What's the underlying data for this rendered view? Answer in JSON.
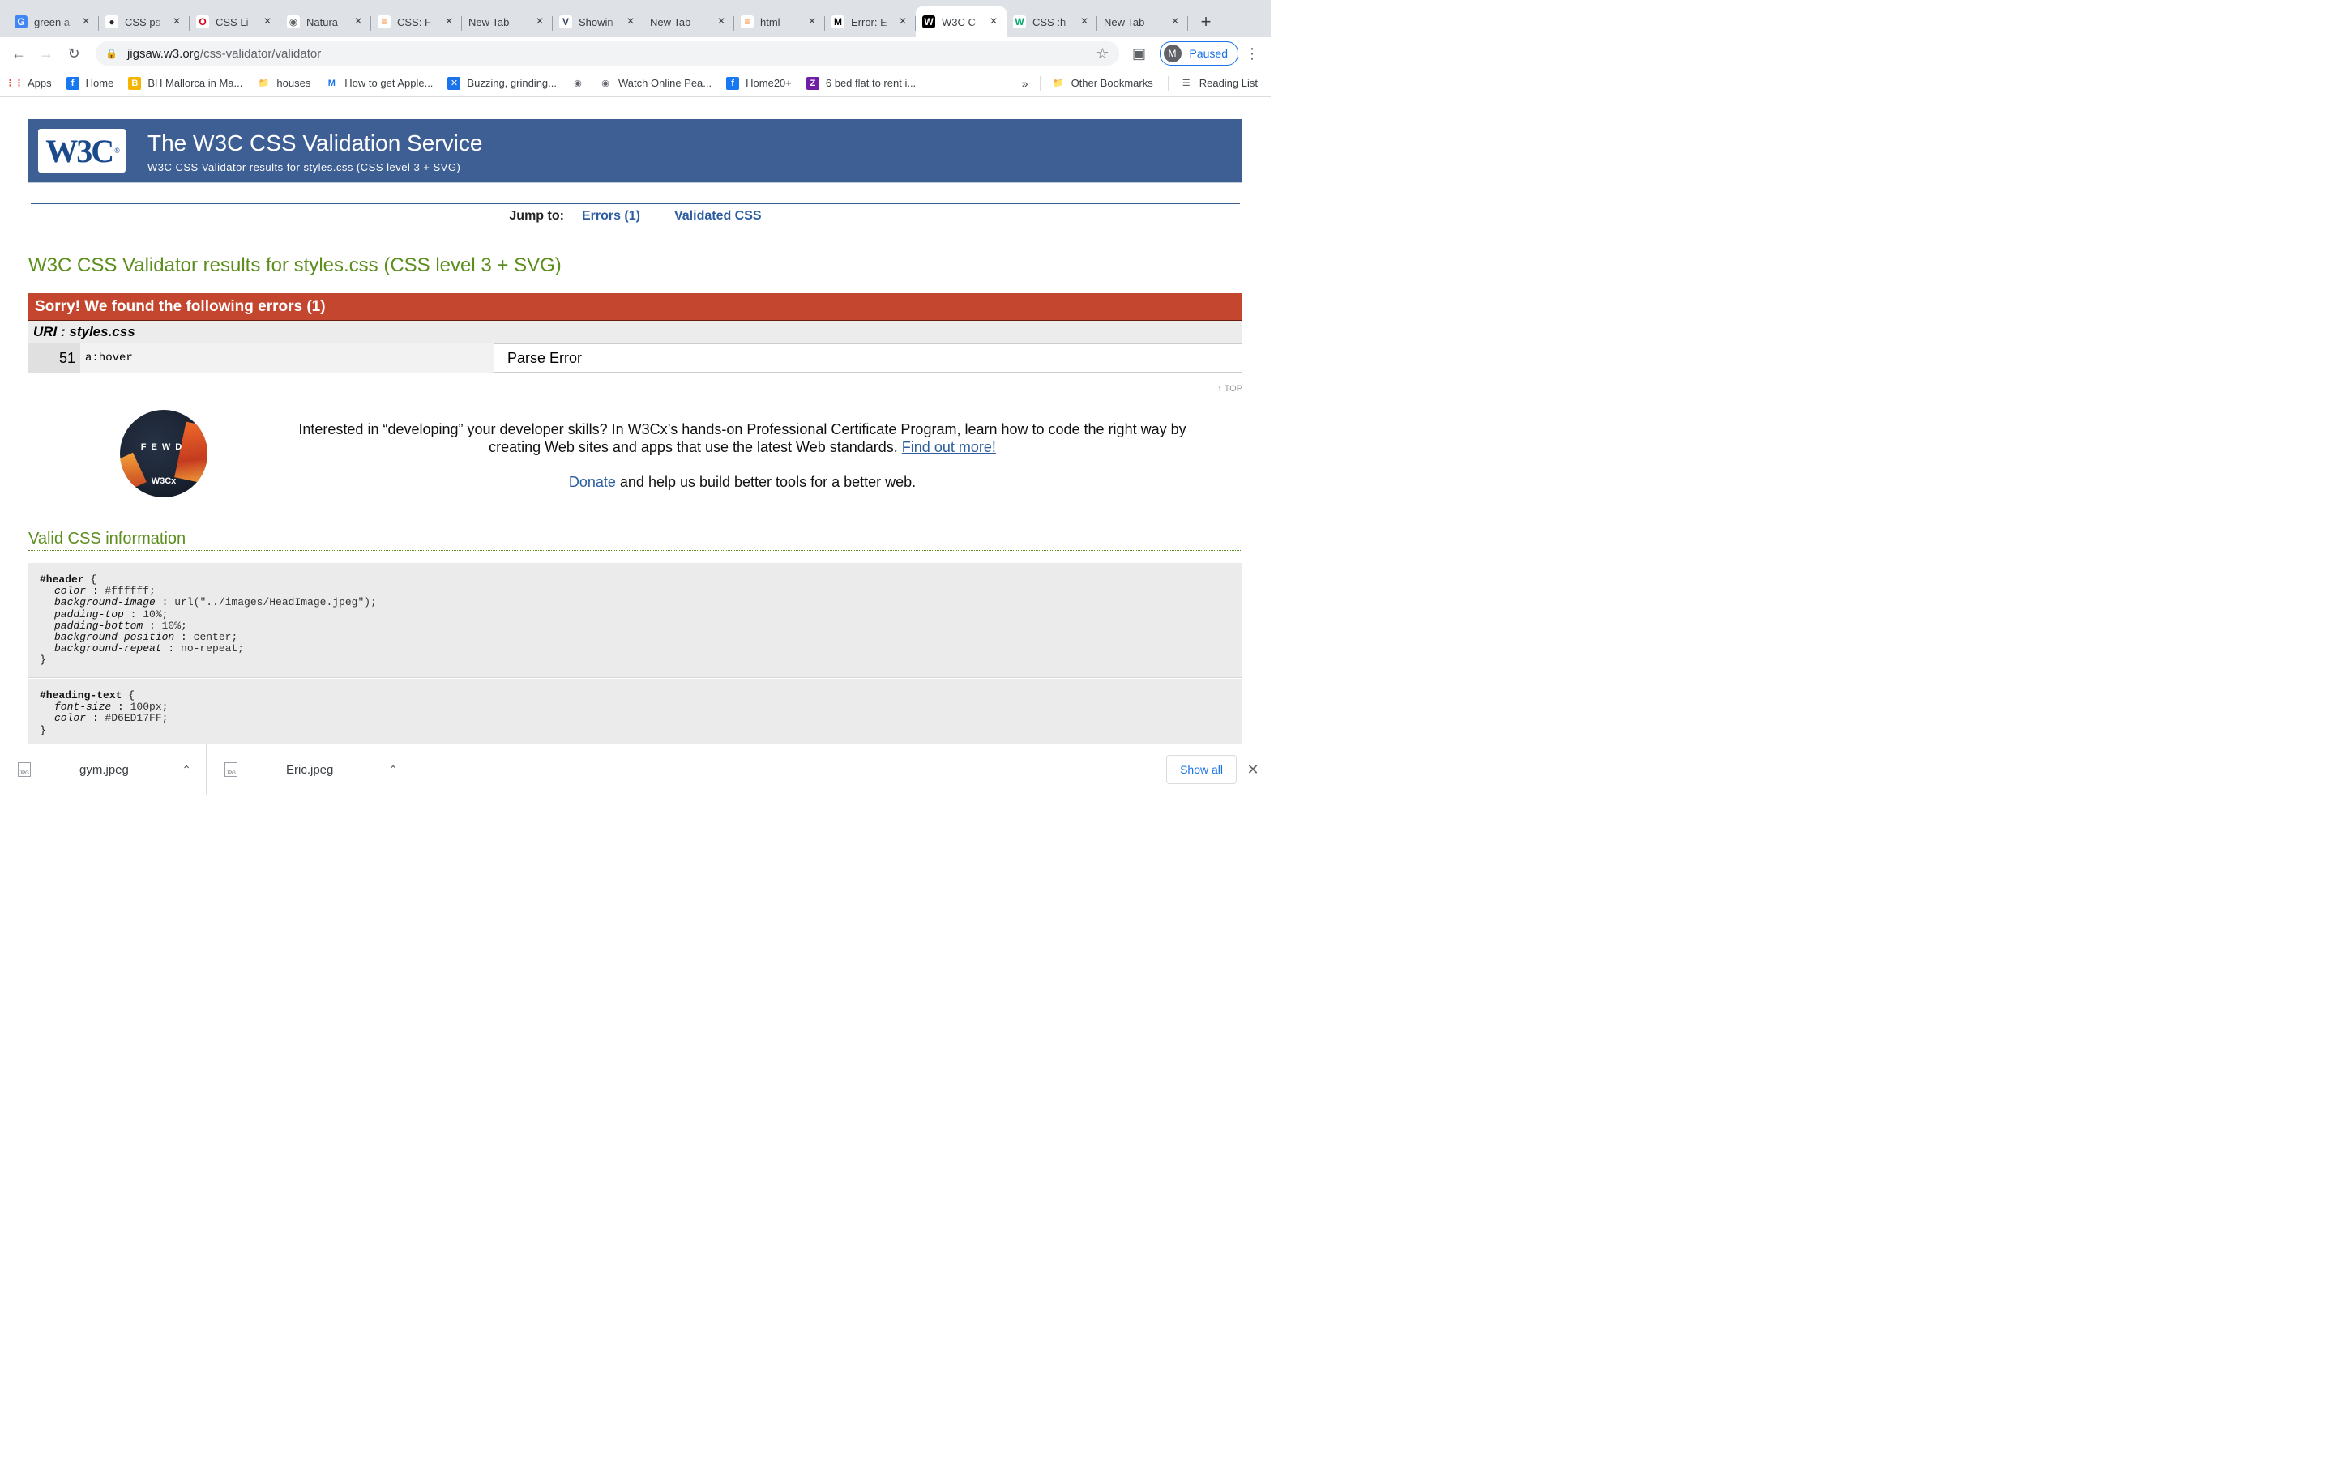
{
  "browser": {
    "tabs": [
      {
        "title": "green a",
        "icon": "google-icon",
        "active": false
      },
      {
        "title": "CSS ps",
        "icon": "github-icon",
        "active": false
      },
      {
        "title": "CSS Li",
        "icon": "opera-icon",
        "active": false
      },
      {
        "title": "Natura",
        "icon": "globe-icon",
        "active": false
      },
      {
        "title": "CSS: F",
        "icon": "stackoverflow-icon",
        "active": false
      },
      {
        "title": "New Tab",
        "icon": "",
        "active": false
      },
      {
        "title": "Showin",
        "icon": "vue-icon",
        "active": false
      },
      {
        "title": "New Tab",
        "icon": "",
        "active": false
      },
      {
        "title": "html - ",
        "icon": "stackoverflow-icon",
        "active": false
      },
      {
        "title": "Error: E",
        "icon": "mdn-icon",
        "active": false
      },
      {
        "title": "W3C C",
        "icon": "w3c-icon",
        "active": true
      },
      {
        "title": "CSS :h",
        "icon": "w3schools-icon",
        "active": false
      },
      {
        "title": "New Tab",
        "icon": "",
        "active": false
      }
    ],
    "url_host": "jigsaw.w3.org",
    "url_path": "/css-validator/validator",
    "profile_initial": "M",
    "profile_status": "Paused",
    "bookmarks": [
      {
        "label": "Apps",
        "icon": "apps-grid-icon"
      },
      {
        "label": "Home",
        "icon": "facebook-icon"
      },
      {
        "label": "BH Mallorca in Ma...",
        "icon": "bh-icon"
      },
      {
        "label": "houses",
        "icon": "folder-icon"
      },
      {
        "label": "How to get Apple...",
        "icon": "medium-icon"
      },
      {
        "label": "Buzzing, grinding...",
        "icon": "x-circle-icon"
      },
      {
        "label": "",
        "icon": "globe-icon"
      },
      {
        "label": "Watch Online Pea...",
        "icon": "globe-icon"
      },
      {
        "label": "Home20+",
        "icon": "facebook-icon"
      },
      {
        "label": "6 bed flat to rent i...",
        "icon": "zoopla-icon"
      }
    ],
    "bookmarks_more": "»",
    "other_bookmarks": "Other Bookmarks",
    "reading_list": "Reading List"
  },
  "page": {
    "logo_text": "W3C",
    "banner_title": "The W3C CSS Validation Service",
    "banner_subtitle": "W3C CSS Validator results for styles.css (CSS level 3 + SVG)",
    "jump_label": "Jump to:",
    "jump_errors": "Errors (1)",
    "jump_validated": "Validated CSS",
    "result_title": "W3C CSS Validator results for styles.css (CSS level 3 + SVG)",
    "error_header": "Sorry! We found the following errors (1)",
    "uri_line": "URI : styles.css",
    "error_row": {
      "line": "51",
      "context": "a:hover",
      "message": "Parse Error"
    },
    "top_link": "↑ TOP",
    "promo_text": "Interested in “developing” your developer skills? In W3Cx’s hands-on Professional Certificate Program, learn how to code the right way by creating Web sites and apps that use the latest Web standards.",
    "promo_link": "Find out more!",
    "donate_link": "Donate",
    "donate_text": " and help us build better tools for a better web.",
    "promo_logo_text": "W3Cx",
    "promo_logo_letters": "FEWD",
    "valid_title": "Valid CSS information",
    "css_blocks": [
      {
        "selector": "#header",
        "props": [
          {
            "name": "color",
            "value": "#ffffff;"
          },
          {
            "name": "background-image",
            "value": "url(\"../images/HeadImage.jpeg\");"
          },
          {
            "name": "padding-top",
            "value": "10%;"
          },
          {
            "name": "padding-bottom",
            "value": "10%;"
          },
          {
            "name": "background-position",
            "value": "center;"
          },
          {
            "name": "background-repeat",
            "value": "no-repeat;"
          }
        ]
      },
      {
        "selector": "#heading-text",
        "props": [
          {
            "name": "font-size",
            "value": "100px;"
          },
          {
            "name": "color",
            "value": "#D6ED17FF;"
          }
        ]
      }
    ]
  },
  "downloads": {
    "items": [
      {
        "name": "gym.jpeg"
      },
      {
        "name": "Eric.jpeg"
      }
    ],
    "show_all": "Show all"
  },
  "colors": {
    "banner": "#3e5f94",
    "error_header": "#c5462e",
    "title_green": "#5c8e1e",
    "link_blue": "#2d5d9f",
    "chrome_blue": "#1a73e8"
  }
}
